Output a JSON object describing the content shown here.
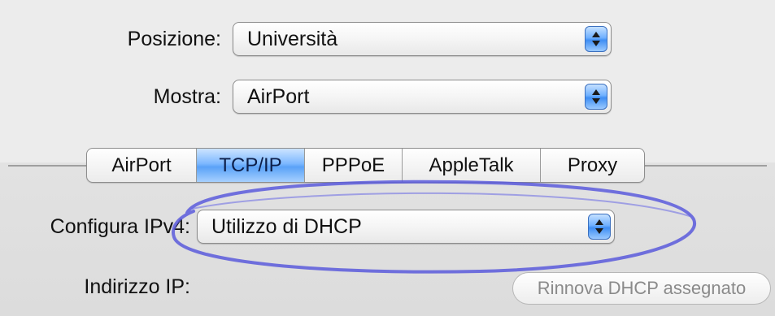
{
  "location": {
    "label": "Posizione:",
    "value": "Università"
  },
  "show": {
    "label": "Mostra:",
    "value": "AirPort"
  },
  "tabs": [
    {
      "label": "AirPort",
      "selected": false
    },
    {
      "label": "TCP/IP",
      "selected": true
    },
    {
      "label": "PPPoE",
      "selected": false
    },
    {
      "label": "AppleTalk",
      "selected": false
    },
    {
      "label": "Proxy",
      "selected": false
    }
  ],
  "ipv4": {
    "label": "Configura IPv4:",
    "value": "Utilizzo di DHCP"
  },
  "ip_address": {
    "label": "Indirizzo IP:"
  },
  "renew_button": {
    "label": "Rinnova DHCP assegnato",
    "enabled": false
  },
  "colors": {
    "selected_tab": "#5aa2f7",
    "popup_arrow": "#3f8ef3",
    "highlight_ellipse": "#5b5bdc"
  },
  "icons": {
    "popup_arrows": "up-down-arrows-icon"
  }
}
